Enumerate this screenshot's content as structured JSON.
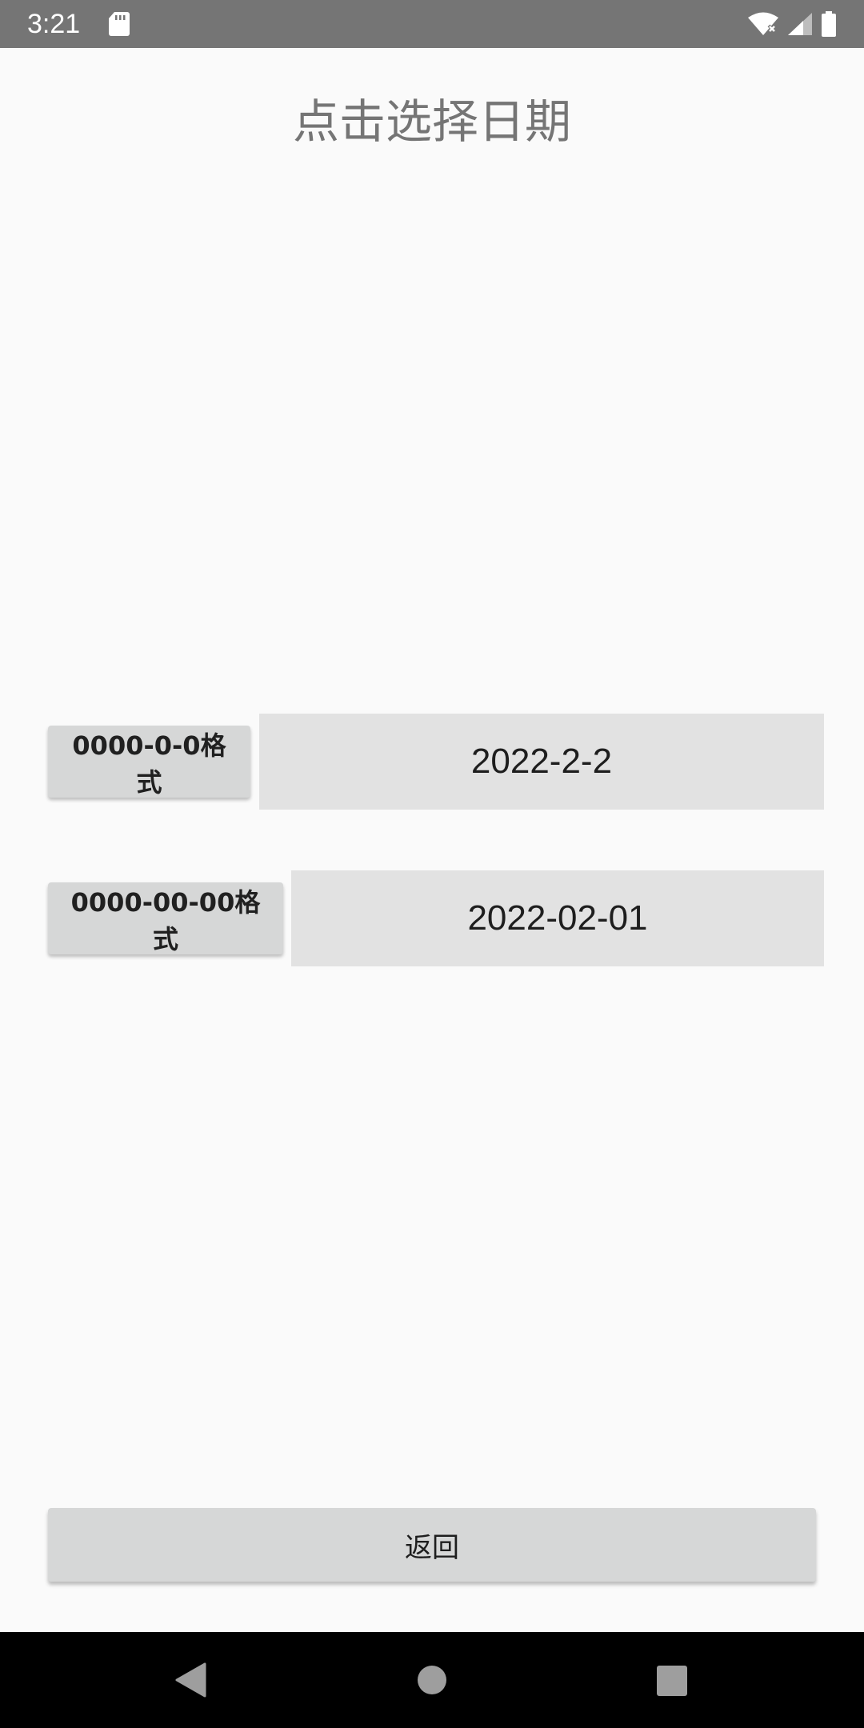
{
  "status_bar": {
    "time": "3:21",
    "icons": [
      "sd-card-icon",
      "wifi-icon",
      "signal-icon",
      "battery-icon"
    ]
  },
  "page": {
    "title": "点击选择日期"
  },
  "rows": [
    {
      "format_label": "0000-0-0格式",
      "date_value": "2022-2-2"
    },
    {
      "format_label": "0000-00-00格式",
      "date_value": "2022-02-01"
    }
  ],
  "back_button": {
    "label": "返回"
  },
  "nav_bar": {
    "icons": [
      "back-triangle-icon",
      "home-circle-icon",
      "recents-square-icon"
    ]
  },
  "colors": {
    "status_bar": "#757575",
    "background": "#fafafa",
    "button": "#d6d7d7",
    "field": "#e2e2e2",
    "title_text": "#757575"
  }
}
